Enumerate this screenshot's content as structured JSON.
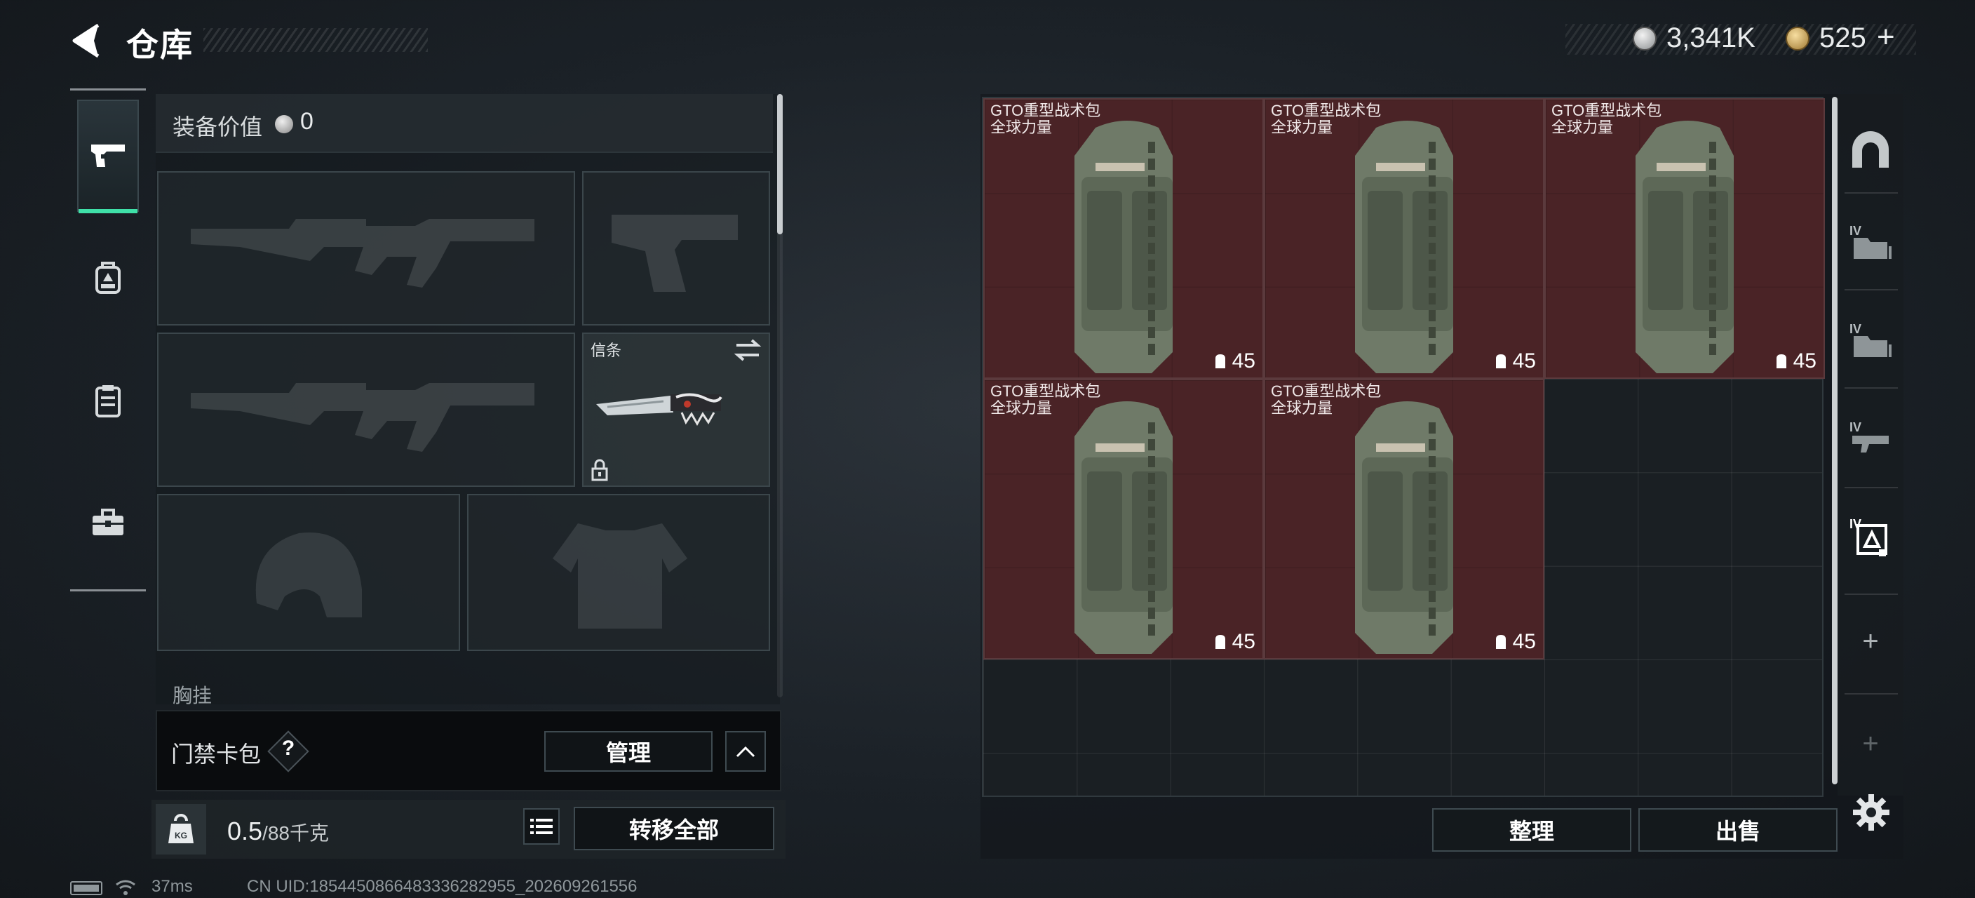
{
  "header": {
    "title": "仓库",
    "back_icon": "back-arrow-icon",
    "currency": [
      {
        "icon": "silver-coin-icon",
        "value": "3,341K"
      },
      {
        "icon": "gold-coin-icon",
        "value": "525"
      }
    ],
    "add_symbol": "+"
  },
  "sidebar": {
    "tabs": [
      {
        "icon": "pistol-icon",
        "active": true
      },
      {
        "icon": "backpack-icon",
        "active": false
      },
      {
        "icon": "vest-icon",
        "active": false
      },
      {
        "icon": "toolbox-icon",
        "active": false
      }
    ]
  },
  "equipment": {
    "value_label": "装备价值",
    "value": "0",
    "slots": {
      "primary_1": "assault-rifle-silhouette",
      "sidearm": "pistol-silhouette",
      "primary_2": "assault-rifle-silhouette",
      "melee_label": "信条",
      "helmet": "helmet-silhouette",
      "armor": "body-armor-silhouette"
    },
    "chest_label": "胸挂"
  },
  "access_card": {
    "label": "门禁卡包",
    "help": "?",
    "manage_label": "管理"
  },
  "weight": {
    "current": "0.5",
    "max": "/88",
    "unit": "千克",
    "icon_text": "KG",
    "transfer_all_label": "转移全部"
  },
  "stash": {
    "items": [
      {
        "name": "GTO重型战术包",
        "tag": "全球力量",
        "capacity": "45"
      },
      {
        "name": "GTO重型战术包",
        "tag": "全球力量",
        "capacity": "45"
      },
      {
        "name": "GTO重型战术包",
        "tag": "全球力量",
        "capacity": "45"
      },
      {
        "name": "GTO重型战术包",
        "tag": "全球力量",
        "capacity": "45"
      },
      {
        "name": "GTO重型战术包",
        "tag": "全球力量",
        "capacity": "45"
      }
    ],
    "sort_label": "整理",
    "sell_label": "出售"
  },
  "rail": {
    "tier_label": "IV",
    "plus": "+"
  },
  "footer": {
    "ping": "37ms",
    "uid": "CN UID:1854450866483336282955_202609261556"
  },
  "colors": {
    "accent": "#3fe0a8",
    "item_background": "#4a2326"
  }
}
